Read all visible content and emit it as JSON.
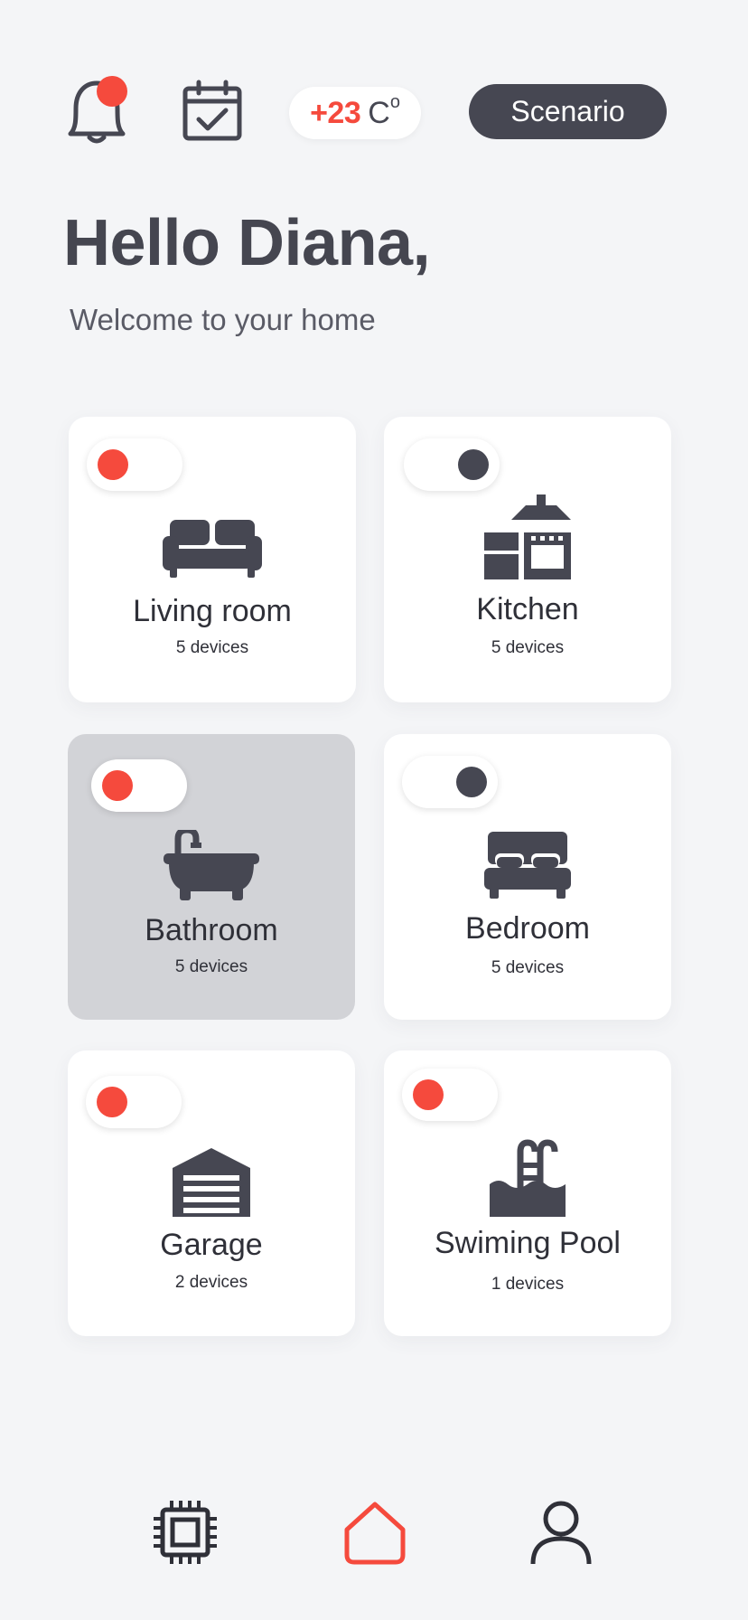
{
  "header": {
    "temperature_value": "+23",
    "temperature_unit": "C",
    "temperature_degree": "o",
    "scenario_label": "Scenario"
  },
  "greeting": {
    "title": "Hello Diana,",
    "subtitle": "Welcome to your home"
  },
  "rooms": [
    {
      "name": "Living room",
      "devices": "5 devices",
      "toggle": "on",
      "icon": "sofa-icon"
    },
    {
      "name": "Kitchen",
      "devices": "5 devices",
      "toggle": "off",
      "icon": "kitchen-icon"
    },
    {
      "name": "Bathroom",
      "devices": "5 devices",
      "toggle": "on",
      "icon": "bathtub-icon",
      "selected": true
    },
    {
      "name": "Bedroom",
      "devices": "5 devices",
      "toggle": "off",
      "icon": "bed-icon"
    },
    {
      "name": "Garage",
      "devices": "2 devices",
      "toggle": "on",
      "icon": "garage-icon"
    },
    {
      "name": "Swiming Pool",
      "devices": "1 devices",
      "toggle": "on",
      "icon": "pool-icon"
    }
  ],
  "nav": [
    {
      "icon": "chip-icon",
      "active": false
    },
    {
      "icon": "home-icon",
      "active": true
    },
    {
      "icon": "profile-icon",
      "active": false
    }
  ],
  "colors": {
    "accent": "#f54a3d",
    "dark": "#464752",
    "background": "#f4f5f7",
    "card": "#ffffff",
    "card_selected": "#d2d3d7"
  }
}
